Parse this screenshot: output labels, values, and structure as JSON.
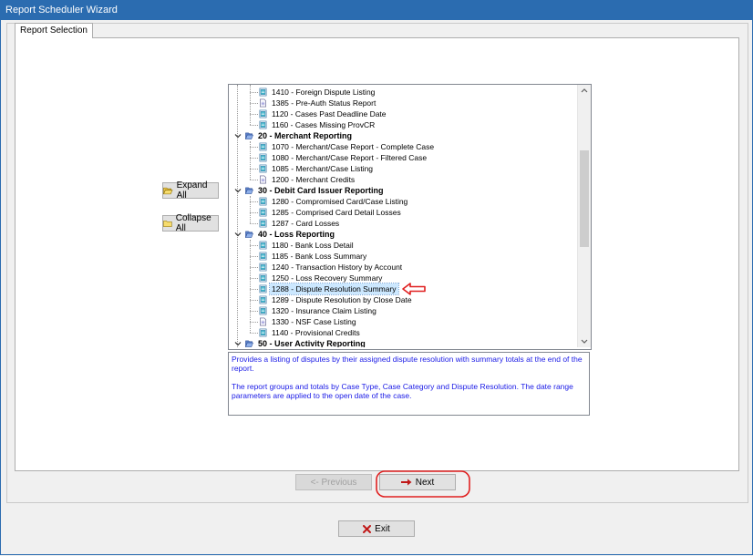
{
  "window": {
    "title": "Report Scheduler Wizard"
  },
  "tabs": [
    {
      "label": "Report Selection"
    }
  ],
  "buttons": {
    "expand_all": "Expand All",
    "collapse_all": "Collapse All",
    "previous": "<- Previous",
    "next": "Next",
    "exit": "Exit"
  },
  "tree": {
    "items": [
      {
        "level": 2,
        "text": "1410 - Foreign Dispute Listing",
        "icon": "report-scheduled-icon"
      },
      {
        "level": 2,
        "text": "1385 - Pre-Auth Status Report",
        "icon": "report-doc-icon"
      },
      {
        "level": 2,
        "text": "1120 - Cases Past Deadline Date",
        "icon": "report-scheduled-icon"
      },
      {
        "level": 2,
        "text": "1160 - Cases Missing ProvCR",
        "icon": "report-scheduled-icon"
      },
      {
        "level": 1,
        "text": "20 - Merchant Reporting",
        "icon": "folder-open-icon"
      },
      {
        "level": 2,
        "text": "1070 - Merchant/Case Report - Complete Case",
        "icon": "report-scheduled-icon"
      },
      {
        "level": 2,
        "text": "1080 - Merchant/Case Report - Filtered Case",
        "icon": "report-scheduled-icon"
      },
      {
        "level": 2,
        "text": "1085 - Merchant/Case Listing",
        "icon": "report-scheduled-icon"
      },
      {
        "level": 2,
        "text": "1200 - Merchant Credits",
        "icon": "report-doc-icon"
      },
      {
        "level": 1,
        "text": "30 - Debit Card Issuer Reporting",
        "icon": "folder-open-icon"
      },
      {
        "level": 2,
        "text": "1280 - Compromised Card/Case Listing",
        "icon": "report-scheduled-icon"
      },
      {
        "level": 2,
        "text": "1285 - Comprised Card Detail Losses",
        "icon": "report-scheduled-icon"
      },
      {
        "level": 2,
        "text": "1287 - Card Losses",
        "icon": "report-scheduled-icon"
      },
      {
        "level": 1,
        "text": "40 - Loss Reporting",
        "icon": "folder-open-icon"
      },
      {
        "level": 2,
        "text": "1180 - Bank Loss Detail",
        "icon": "report-scheduled-icon"
      },
      {
        "level": 2,
        "text": "1185 - Bank Loss Summary",
        "icon": "report-scheduled-icon"
      },
      {
        "level": 2,
        "text": "1240 - Transaction History by Account",
        "icon": "report-scheduled-icon"
      },
      {
        "level": 2,
        "text": "1250 - Loss Recovery Summary",
        "icon": "report-scheduled-icon"
      },
      {
        "level": 2,
        "text": "1288 - Dispute Resolution Summary",
        "icon": "report-scheduled-icon",
        "selected": true
      },
      {
        "level": 2,
        "text": "1289 - Dispute Resolution by Close Date",
        "icon": "report-scheduled-icon"
      },
      {
        "level": 2,
        "text": "1320 - Insurance Claim Listing",
        "icon": "report-scheduled-icon"
      },
      {
        "level": 2,
        "text": "1330 - NSF Case Listing",
        "icon": "report-doc-icon"
      },
      {
        "level": 2,
        "text": "1140 - Provisional Credits",
        "icon": "report-scheduled-icon"
      },
      {
        "level": 1,
        "text": "50 - User Activity Reporting",
        "icon": "folder-open-icon"
      }
    ]
  },
  "description": {
    "paragraphs": [
      "Provides a listing of disputes by their assigned dispute resolution with summary totals at the end of the report.",
      "The report groups and totals by Case Type, Case Category and Dispute Resolution.  The date range parameters are applied to the open date of the case."
    ]
  },
  "colors": {
    "title_bar": "#2b6cb0",
    "description_text": "#1a1ae6",
    "annotation_red": "#e02020",
    "selection_bg": "#cce8ff"
  }
}
